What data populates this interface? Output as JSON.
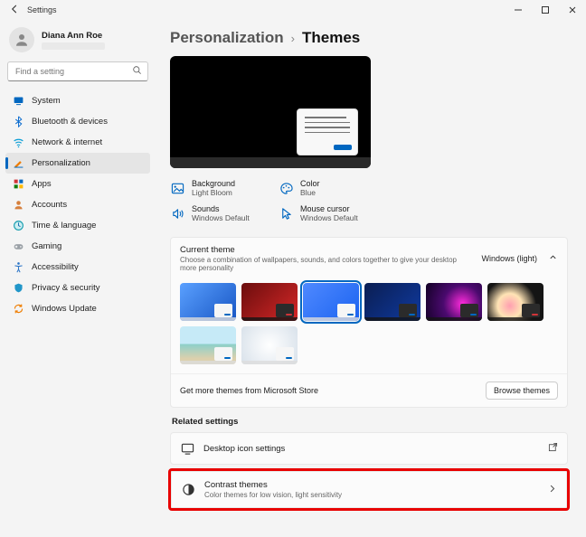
{
  "window": {
    "title": "Settings"
  },
  "user": {
    "name": "Diana Ann Roe"
  },
  "search": {
    "placeholder": "Find a setting"
  },
  "nav": [
    {
      "id": "system",
      "label": "System"
    },
    {
      "id": "bluetooth",
      "label": "Bluetooth & devices"
    },
    {
      "id": "network",
      "label": "Network & internet"
    },
    {
      "id": "personalization",
      "label": "Personalization",
      "selected": true
    },
    {
      "id": "apps",
      "label": "Apps"
    },
    {
      "id": "accounts",
      "label": "Accounts"
    },
    {
      "id": "time",
      "label": "Time & language"
    },
    {
      "id": "gaming",
      "label": "Gaming"
    },
    {
      "id": "accessibility",
      "label": "Accessibility"
    },
    {
      "id": "privacy",
      "label": "Privacy & security"
    },
    {
      "id": "update",
      "label": "Windows Update"
    }
  ],
  "breadcrumb": {
    "parent": "Personalization",
    "current": "Themes"
  },
  "shortcuts": {
    "bg_label": "Background",
    "bg_value": "Light Bloom",
    "color_label": "Color",
    "color_value": "Blue",
    "sound_label": "Sounds",
    "sound_value": "Windows Default",
    "cursor_label": "Mouse cursor",
    "cursor_value": "Windows Default"
  },
  "themes_panel": {
    "title": "Current theme",
    "subtitle": "Choose a combination of wallpapers, sounds, and colors together to give your desktop more personality",
    "selected_name": "Windows (light)",
    "store_text": "Get more themes from Microsoft Store",
    "browse_label": "Browse themes",
    "items": [
      {
        "id": "win-light-bloom",
        "bg": "linear-gradient(135deg,#5aa0ff,#1856c4)",
        "dark": false
      },
      {
        "id": "glow",
        "bg": "linear-gradient(135deg,#6b0d0d,#d62828)",
        "dark": true,
        "redmini": true
      },
      {
        "id": "win-light",
        "bg": "linear-gradient(135deg,#4f89ff,#1b63f0)",
        "dark": false,
        "selected": true
      },
      {
        "id": "win-dark",
        "bg": "linear-gradient(135deg,#0b1e52,#0f3aa0)",
        "dark": true
      },
      {
        "id": "spotlight",
        "bg": "radial-gradient(circle at 65% 55%,#ff2bdc 0%,#4a0a6e 45%,#120024 100%)",
        "dark": true
      },
      {
        "id": "flowers",
        "bg": "radial-gradient(circle at 40% 60%,#ff9fb0 0%,#ffe4b5 30%,#141414 65%)",
        "dark": true,
        "redmini": true
      },
      {
        "id": "beach",
        "bg": "linear-gradient(#c6eaf7 45%,#8ed0c9 48%,#dcd0ad 85%)",
        "dark": false
      },
      {
        "id": "silk",
        "bg": "radial-gradient(circle at 50% 50%,#ffffff,#d8e1ea)",
        "dark": false
      }
    ]
  },
  "related": {
    "heading": "Related settings",
    "desktop_icons": "Desktop icon settings",
    "contrast_title": "Contrast themes",
    "contrast_sub": "Color themes for low vision, light sensitivity"
  }
}
